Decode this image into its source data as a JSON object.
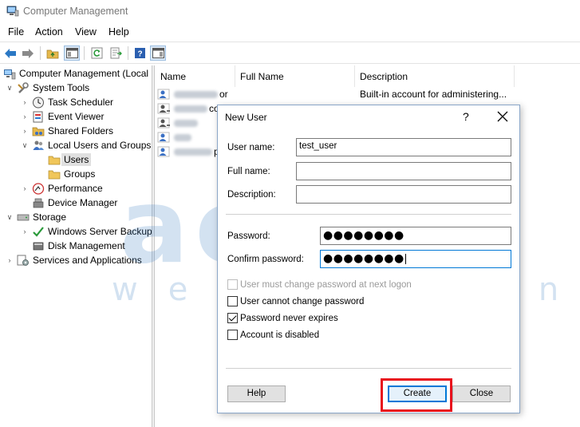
{
  "window": {
    "title": "Computer Management"
  },
  "menu": [
    "File",
    "Action",
    "View",
    "Help"
  ],
  "toolbar": {
    "buttons": [
      "back-arrow-icon",
      "forward-arrow-icon",
      "up-folder-icon",
      "show-hide-tree-icon",
      "refresh-icon",
      "export-list-icon",
      "help-icon",
      "action-pane-icon"
    ]
  },
  "tree": {
    "root": "Computer Management (Local",
    "system_tools": "System Tools",
    "task_scheduler": "Task Scheduler",
    "event_viewer": "Event Viewer",
    "shared_folders": "Shared Folders",
    "local_users_groups": "Local Users and Groups",
    "users": "Users",
    "groups": "Groups",
    "performance": "Performance",
    "device_manager": "Device Manager",
    "storage": "Storage",
    "windows_server_backup": "Windows Server Backup",
    "disk_management": "Disk Management",
    "services_apps": "Services and Applications"
  },
  "list": {
    "columns": [
      "Name",
      "Full Name",
      "Description"
    ],
    "rows": [
      {
        "name_tail": "or",
        "description": "Built-in account for administering..."
      },
      {
        "name_tail": "co",
        "description": ""
      },
      {
        "name_tail": "",
        "description": ""
      },
      {
        "name_tail": "",
        "description": ""
      },
      {
        "name_tail": "p",
        "description": ""
      }
    ]
  },
  "watermark": {
    "brand": "accu",
    "tagline": "web hosting"
  },
  "dialog": {
    "title": "New User",
    "help_glyph": "?",
    "fields": {
      "username_label": "User name:",
      "username_value": "test_user",
      "fullname_label": "Full name:",
      "fullname_value": "",
      "description_label": "Description:",
      "description_value": "",
      "password_label": "Password:",
      "password_value": "●●●●●●●●",
      "confirm_label": "Confirm password:",
      "confirm_value": "●●●●●●●●"
    },
    "options": [
      {
        "label": "User must change password at next logon",
        "checked": false,
        "enabled": false
      },
      {
        "label": "User cannot change password",
        "checked": false,
        "enabled": true
      },
      {
        "label": "Password never expires",
        "checked": true,
        "enabled": true
      },
      {
        "label": "Account is disabled",
        "checked": false,
        "enabled": true
      }
    ],
    "buttons": {
      "help": "Help",
      "create": "Create",
      "close": "Close"
    }
  },
  "colors": {
    "accent": "#0078d7",
    "highlight": "#e8101c",
    "watermark": "#3b7fc4"
  }
}
